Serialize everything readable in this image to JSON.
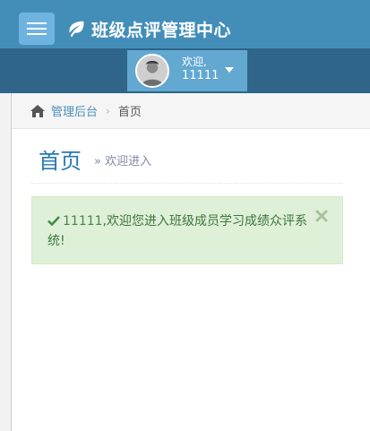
{
  "navbar": {
    "brand_title": "班级点评管理中心"
  },
  "user": {
    "greeting": "欢迎,",
    "name": "11111"
  },
  "breadcrumb": {
    "home": "管理后台",
    "current": "首页"
  },
  "page": {
    "title": "首页",
    "subtitle": "欢迎进入"
  },
  "alert": {
    "username": "11111",
    "message": ",欢迎您进入班级成员学习成绩众评系统!"
  },
  "colors": {
    "navbar": "#438eb9",
    "userbar": "#2e6589",
    "accent": "#2679b5",
    "success_bg": "#dff0d8",
    "success_text": "#3c763d"
  }
}
